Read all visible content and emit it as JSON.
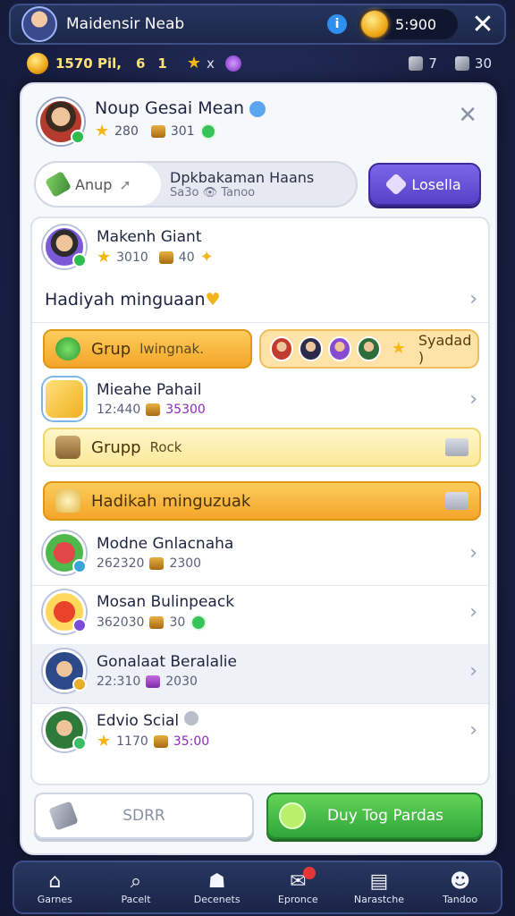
{
  "header": {
    "player_name": "Maidensir Neab",
    "info_icon": "info-icon",
    "coins": "5:900",
    "close_label": "✕"
  },
  "resources": {
    "gold": "1570 Pil,",
    "level_a": "6",
    "level_b": "1",
    "star_x": "x",
    "gem_count": "7",
    "stone_count": "30"
  },
  "profile": {
    "name": "Noup Gesai Mean",
    "stars": "280",
    "chests": "301"
  },
  "search": {
    "placeholder": "Anup",
    "line1": "Dpkbakaman Haans",
    "line2": "Sa3o 👁 Tanoo",
    "button_label": "Losella"
  },
  "list": {
    "top_item": {
      "name": "Makenh Giant",
      "stars": "3010",
      "chests": "40"
    },
    "section_title": "Hadiyah minguaan",
    "group_bar": {
      "label": "Grup",
      "sub": "lwingnak.",
      "pill_label": "Syadad )"
    },
    "item_a": {
      "name": "Mieahe Pahail",
      "value1": "12:440",
      "value2": "35300"
    },
    "group_bar2": {
      "label": "Grupp",
      "sub": "Rock"
    },
    "section_bar": {
      "label": "Hadikah minguzuak"
    },
    "item_b": {
      "name": "Modne Gnlacnaha",
      "value1": "262320",
      "value2": "2300"
    },
    "item_c": {
      "name": "Mosan Bulinpeack",
      "value1": "362030",
      "value2": "30"
    },
    "item_d": {
      "name": "Gonalaat Beralalie",
      "value1": "22:310",
      "value2": "2030"
    },
    "item_e": {
      "name": "Edvio Scial",
      "value1": "1170",
      "value2": "35:00"
    }
  },
  "buttons": {
    "secondary": "SDRR",
    "primary": "Duy Tog Pardas"
  },
  "nav": {
    "tabs": [
      "Garnes",
      "Pacelt",
      "Decenets",
      "Epronce",
      "Narastche",
      "Tandoo"
    ]
  },
  "colors": {
    "accent_purple": "#5740c8",
    "accent_green": "#2fa63a",
    "accent_orange": "#f4a52a"
  }
}
